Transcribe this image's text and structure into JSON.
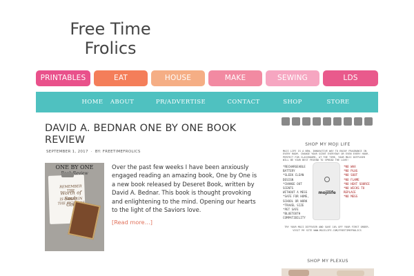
{
  "site": {
    "title_line1": "Free Time",
    "title_line2": "Frolics"
  },
  "category_nav": [
    {
      "label": "PRINTABLES",
      "color": "#e9518b"
    },
    {
      "label": "EAT",
      "color": "#f47e5a"
    },
    {
      "label": "HOUSE",
      "color": "#f5ae85"
    },
    {
      "label": "MAKE",
      "color": "#f28aa2"
    },
    {
      "label": "SEWING",
      "color": "#f6a6c1"
    },
    {
      "label": "LDS",
      "color": "#e95a8c"
    }
  ],
  "main_nav": {
    "bg_color": "#4fc1c0",
    "items": [
      "HOME",
      "ABOUT",
      "PR/ADVERTISE",
      "CONTACT",
      "SHOP",
      "STORE"
    ]
  },
  "post": {
    "title_line1": "DAVID A. BEDNAR ONE BY ONE BOOK",
    "title_line2": "REVIEW",
    "date": "SEPTEMBER 1, 2017",
    "author": "BY: FREETIMEFROLICS",
    "excerpt": "Over the past few weeks I have been anxiously engaged reading an amazing book, One by One is a new book released by Deseret Book, written by David A. Bednar.  This book is thought provoking and enlightening to the mind.  Opening our hearts to the light of the Saviors love.",
    "read_more": "[Read more…]",
    "thumbnail": {
      "title": "ONE BY ONE",
      "subtitle": "Book Review",
      "line1": "REMEMBER THE",
      "line2": "Worth of Souls",
      "line3": "IS GREAT IN THE SIGHT OF",
      "line4": "God"
    }
  },
  "sidebar": {
    "social_icons": [
      "facebook-icon",
      "twitter-icon",
      "pinterest-icon",
      "instagram-icon",
      "google-plus-icon",
      "youtube-icon",
      "email-icon",
      "rss-icon",
      "bloglovin-icon"
    ],
    "widget1_title": "SHOP MY MOJI LIFE",
    "moji_ad": {
      "intro": "MOJI LIFE IS A NEW, INNOVATIVE WAY TO ENJOY FRAGRANCE IN EVERY ROOM. CHANGE YOUR SCENT EVERYDAY OR EVEN EVERY HOUR. PERFECT FOR CLASSROOMS, AT THE TIME, YOUR MOJI DIFFUSER WILL BE YOUR BEST FRIEND TO SPREAD THE LOVE!",
      "left_list": [
        "*RECHARGEABLE BATTERY",
        "*SLEEK CLEAN DESIGN",
        "*CHANGE OUT SCENTS",
        "  WITHOUT A MESS",
        "*SAFE FOR HOME,",
        "  SCHOOL OR WORK",
        "*TRAVEL SIZE",
        "*PET SAFE",
        "*BLUETOOTH",
        "  COMPATIBILITY"
      ],
      "right_list": [
        "*NO WAX",
        "*NO PLUG",
        "*NO SOOT",
        "*NO FLAME",
        "*NO HEAT SOURCE",
        "*NO WICKS TO",
        "  REPLACE",
        "*NO MESS"
      ],
      "device_logo": "mojilife",
      "outro": "TRY YOUR MOJI DIFFUSER AND SAVE 10% OFF YOUR FIRST ORDER. VISIT MY SITE WWW.MOJILIFE.COM/FREETIMEFROLICS"
    },
    "widget2_title": "SHOP MY PLEXUS"
  }
}
